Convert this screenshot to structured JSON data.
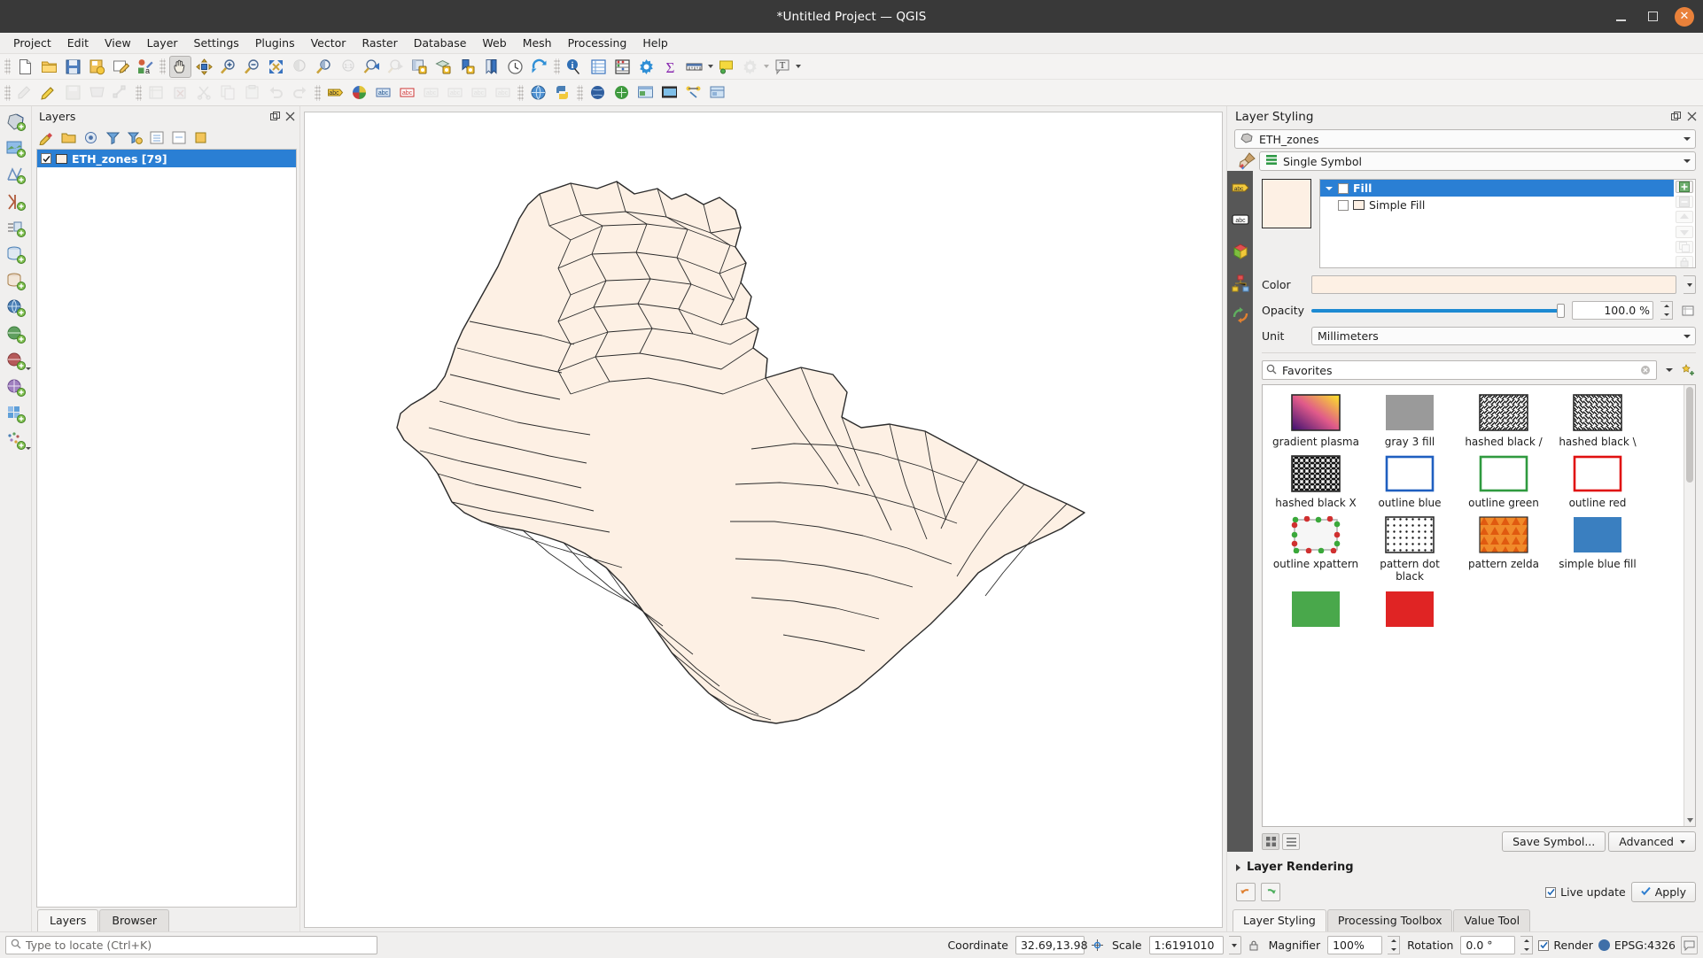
{
  "window": {
    "title": "*Untitled Project — QGIS",
    "minimize": "–",
    "maximize": "□",
    "close": "✕"
  },
  "menubar": {
    "items": [
      "Project",
      "Edit",
      "View",
      "Layer",
      "Settings",
      "Plugins",
      "Vector",
      "Raster",
      "Database",
      "Web",
      "Mesh",
      "Processing",
      "Help"
    ]
  },
  "toolbar_row1": [
    {
      "name": "new-project-icon",
      "title": "New Project"
    },
    {
      "name": "open-project-icon",
      "title": "Open Project"
    },
    {
      "name": "save-project-icon",
      "title": "Save Project"
    },
    {
      "name": "save-project-as-icon",
      "title": "Save Project As"
    },
    {
      "name": "new-print-layout-icon",
      "title": "New Print Layout"
    },
    {
      "name": "style-manager-icon",
      "title": "Style Manager"
    },
    {
      "name": "pan-map-icon",
      "title": "Pan Map"
    },
    {
      "name": "pan-to-selection-icon",
      "title": "Pan Map to Selection"
    },
    {
      "name": "zoom-in-icon",
      "title": "Zoom In"
    },
    {
      "name": "zoom-out-icon",
      "title": "Zoom Out"
    },
    {
      "name": "zoom-full-icon",
      "title": "Zoom Full"
    },
    {
      "name": "zoom-to-selection-icon",
      "title": "Zoom to Selection"
    },
    {
      "name": "zoom-to-layer-icon",
      "title": "Zoom to Layer"
    },
    {
      "name": "zoom-native-icon",
      "title": "Zoom to Native Resolution"
    },
    {
      "name": "zoom-last-icon",
      "title": "Zoom Last"
    },
    {
      "name": "zoom-next-icon",
      "title": "Zoom Next"
    },
    {
      "name": "new-map-view-icon",
      "title": "New Map View"
    },
    {
      "name": "new-3d-map-view-icon",
      "title": "New 3D Map View"
    },
    {
      "name": "refresh-bookmark-icon",
      "title": "Show Bookmarks"
    },
    {
      "name": "new-bookmark-icon",
      "title": "New Bookmark"
    },
    {
      "name": "temporal-controller-icon",
      "title": "Temporal Controller"
    },
    {
      "name": "refresh-icon",
      "title": "Refresh"
    },
    {
      "name": "identify-features-icon",
      "title": "Identify Features"
    },
    {
      "name": "attribute-table-icon",
      "title": "Open Attribute Table"
    },
    {
      "name": "field-calculator-icon",
      "title": "Field Calculator"
    },
    {
      "name": "options-icon",
      "title": "Options"
    },
    {
      "name": "statistics-icon",
      "title": "Statistical Summary"
    },
    {
      "name": "measure-line-icon",
      "title": "Measure Line"
    },
    {
      "name": "map-tips-icon",
      "title": "Show Map Tips"
    },
    {
      "name": "run-feature-action-icon",
      "title": "Run Feature Action"
    },
    {
      "name": "text-annotation-icon",
      "title": "Text Annotation"
    }
  ],
  "toolbar_row2": [
    {
      "name": "current-edits-icon",
      "title": "Current Edits"
    },
    {
      "name": "toggle-editing-icon",
      "title": "Toggle Editing"
    },
    {
      "name": "save-layer-edits-icon",
      "title": "Save Layer Edits"
    },
    {
      "name": "add-feature-icon",
      "title": "Add Polygon Feature"
    },
    {
      "name": "vertex-tool-icon",
      "title": "Vertex Tool"
    },
    {
      "name": "modify-attributes-icon",
      "title": "Modify Attributes of Features"
    },
    {
      "name": "delete-selected-icon",
      "title": "Delete Selected"
    },
    {
      "name": "cut-features-icon",
      "title": "Cut Features"
    },
    {
      "name": "copy-features-icon",
      "title": "Copy Features"
    },
    {
      "name": "paste-features-icon",
      "title": "Paste Features"
    },
    {
      "name": "undo-icon",
      "title": "Undo"
    },
    {
      "name": "redo-icon",
      "title": "Redo"
    },
    {
      "name": "label-toolbar-icon",
      "title": "Layer Labeling Options"
    },
    {
      "name": "style-dock-icon",
      "title": "Layer Styling Panel"
    },
    {
      "name": "pin-labels-icon",
      "title": "Pin/Unpin Labels"
    },
    {
      "name": "highlight-labels-icon",
      "title": "Highlight Pinned Labels"
    },
    {
      "name": "move-label-icon",
      "title": "Move Label"
    },
    {
      "name": "rotate-label-icon",
      "title": "Rotate Label"
    },
    {
      "name": "change-label-icon",
      "title": "Change Label"
    },
    {
      "name": "metasearch-icon",
      "title": "MetaSearch"
    },
    {
      "name": "python-console-icon",
      "title": "Python Console"
    },
    {
      "name": "globe-plugin-icon",
      "title": "Web Plugin"
    },
    {
      "name": "georeferencer-icon",
      "title": "Georeferencer"
    },
    {
      "name": "qgis2web-icon",
      "title": "qgis2web"
    },
    {
      "name": "help-contents-icon",
      "title": "Help Contents"
    },
    {
      "name": "processing-toolbox-icon",
      "title": "Processing Toolbox"
    },
    {
      "name": "model-designer-icon",
      "title": "Model Designer"
    },
    {
      "name": "value-tool-icon",
      "title": "Value Tool"
    },
    {
      "name": "plugin-manager-icon",
      "title": "Plugin Manager"
    }
  ],
  "left_rail": [
    {
      "name": "add-vector-layer-icon",
      "title": "Add Vector Layer"
    },
    {
      "name": "add-raster-layer-icon",
      "title": "Add Raster Layer"
    },
    {
      "name": "add-mesh-layer-icon",
      "title": "Add Mesh Layer"
    },
    {
      "name": "add-delimited-text-layer-icon",
      "title": "Add Delimited Text Layer"
    },
    {
      "name": "add-spatialite-layer-icon",
      "title": "Add SpatiaLite Layer"
    },
    {
      "name": "add-postgis-layer-icon",
      "title": "Add PostGIS Layer"
    },
    {
      "name": "add-mssql-layer-icon",
      "title": "Add MSSQL Layer"
    },
    {
      "name": "add-oracle-layer-icon",
      "title": "Add Oracle Layer"
    },
    {
      "name": "add-wms-layer-icon",
      "title": "Add WMS/WMTS Layer"
    },
    {
      "name": "add-wcs-layer-icon",
      "title": "Add WCS Layer"
    },
    {
      "name": "add-wfs-layer-icon",
      "title": "Add WFS Layer"
    },
    {
      "name": "add-vector-tile-layer-icon",
      "title": "Add Vector Tile Layer"
    },
    {
      "name": "add-point-cloud-layer-icon",
      "title": "Add Point Cloud Layer"
    }
  ],
  "layers_panel": {
    "title": "Layers",
    "toolbar": [
      {
        "name": "open-layer-styling-panel-icon",
        "title": "Open the Layer Styling panel"
      },
      {
        "name": "add-group-icon",
        "title": "Add Group"
      },
      {
        "name": "manage-map-themes-icon",
        "title": "Manage Map Themes"
      },
      {
        "name": "filter-legend-icon",
        "title": "Filter Legend"
      },
      {
        "name": "filter-legend-expression-icon",
        "title": "Filter Legend by Expression"
      },
      {
        "name": "expand-all-icon",
        "title": "Expand All"
      },
      {
        "name": "collapse-all-icon",
        "title": "Collapse All"
      },
      {
        "name": "remove-layer-icon",
        "title": "Remove Layer/Group"
      }
    ],
    "layers": [
      {
        "name": "ETH_zones [79]",
        "checked": true,
        "swatch": "#fdf0e4"
      }
    ],
    "tabs": [
      {
        "label": "Layers",
        "selected": true
      },
      {
        "label": "Browser",
        "selected": false
      }
    ]
  },
  "layer_styling": {
    "title": "Layer Styling",
    "layer_combo": "ETH_zones",
    "renderer_combo": "Single Symbol",
    "vertical_tabs": [
      {
        "name": "labels-tab-icon",
        "title": "Labels"
      },
      {
        "name": "masks-tab-icon",
        "title": "Masks"
      },
      {
        "name": "3d-view-tab-icon",
        "title": "3D View"
      },
      {
        "name": "diagrams-tab-icon",
        "title": "Diagrams"
      },
      {
        "name": "history-tab-icon",
        "title": "History"
      }
    ],
    "symbol_tree": [
      {
        "label": "Fill",
        "level": 0,
        "selected": true
      },
      {
        "label": "Simple Fill",
        "level": 1,
        "selected": false
      }
    ],
    "tree_buttons": [
      {
        "name": "add-symbol-layer-button",
        "title": "Add symbol layer"
      },
      {
        "name": "remove-symbol-layer-button",
        "title": "Remove symbol layer"
      },
      {
        "name": "move-symbol-layer-up-button",
        "title": "Move up"
      },
      {
        "name": "move-symbol-layer-down-button",
        "title": "Move down"
      },
      {
        "name": "duplicate-symbol-layer-button",
        "title": "Duplicate"
      },
      {
        "name": "lock-symbol-layer-button",
        "title": "Lock layer colors"
      }
    ],
    "color_label": "Color",
    "color_value": "#fdf0e4",
    "opacity_label": "Opacity",
    "opacity_value": "100.0 %",
    "opacity_percent": 100,
    "unit_label": "Unit",
    "unit_value": "Millimeters",
    "search_value": "Favorites",
    "gallery": [
      {
        "label": "gradient plasma",
        "kind": "gradient"
      },
      {
        "label": "gray 3 fill",
        "kind": "gray"
      },
      {
        "label": "hashed black /",
        "kind": "hatch-fwd"
      },
      {
        "label": "hashed black \\",
        "kind": "hatch-back"
      },
      {
        "label": "hashed black X",
        "kind": "hatch-x"
      },
      {
        "label": "outline blue",
        "kind": "outline-blue"
      },
      {
        "label": "outline green",
        "kind": "outline-green"
      },
      {
        "label": "outline red",
        "kind": "outline-red"
      },
      {
        "label": "outline xpattern",
        "kind": "xpattern"
      },
      {
        "label": "pattern dot black",
        "kind": "dots"
      },
      {
        "label": "pattern zelda",
        "kind": "zelda"
      },
      {
        "label": "simple blue fill",
        "kind": "blue-fill"
      },
      {
        "label": "",
        "kind": "green-fill"
      },
      {
        "label": "",
        "kind": "red-fill"
      }
    ],
    "save_symbol_label": "Save Symbol...",
    "advanced_label": "Advanced",
    "layer_rendering_label": "Layer Rendering",
    "live_update_label": "Live update",
    "live_update_checked": true,
    "apply_label": "Apply",
    "tabs": [
      {
        "label": "Layer Styling",
        "selected": true
      },
      {
        "label": "Processing Toolbox",
        "selected": false
      },
      {
        "label": "Value Tool",
        "selected": false
      }
    ]
  },
  "statusbar": {
    "locate_placeholder": "Type to locate (Ctrl+K)",
    "coordinate_label": "Coordinate",
    "coordinate_value": "32.69,13.98",
    "scale_label": "Scale",
    "scale_value": "1:6191010",
    "magnifier_label": "Magnifier",
    "magnifier_value": "100%",
    "rotation_label": "Rotation",
    "rotation_value": "0.0 °",
    "render_label": "Render",
    "render_checked": true,
    "crs_value": "EPSG:4326"
  },
  "colors": {
    "accent": "#2a7fd4",
    "titlebar": "#393939",
    "close_button": "#e9813a",
    "map_fill": "#fdf0e4",
    "map_stroke": "#2b2b2b",
    "slider": "#1d8ad2"
  },
  "map": {
    "layer_fill": "#fdf0e4",
    "layer_outline": "#2b2b2b",
    "region": "Ethiopia zones"
  }
}
